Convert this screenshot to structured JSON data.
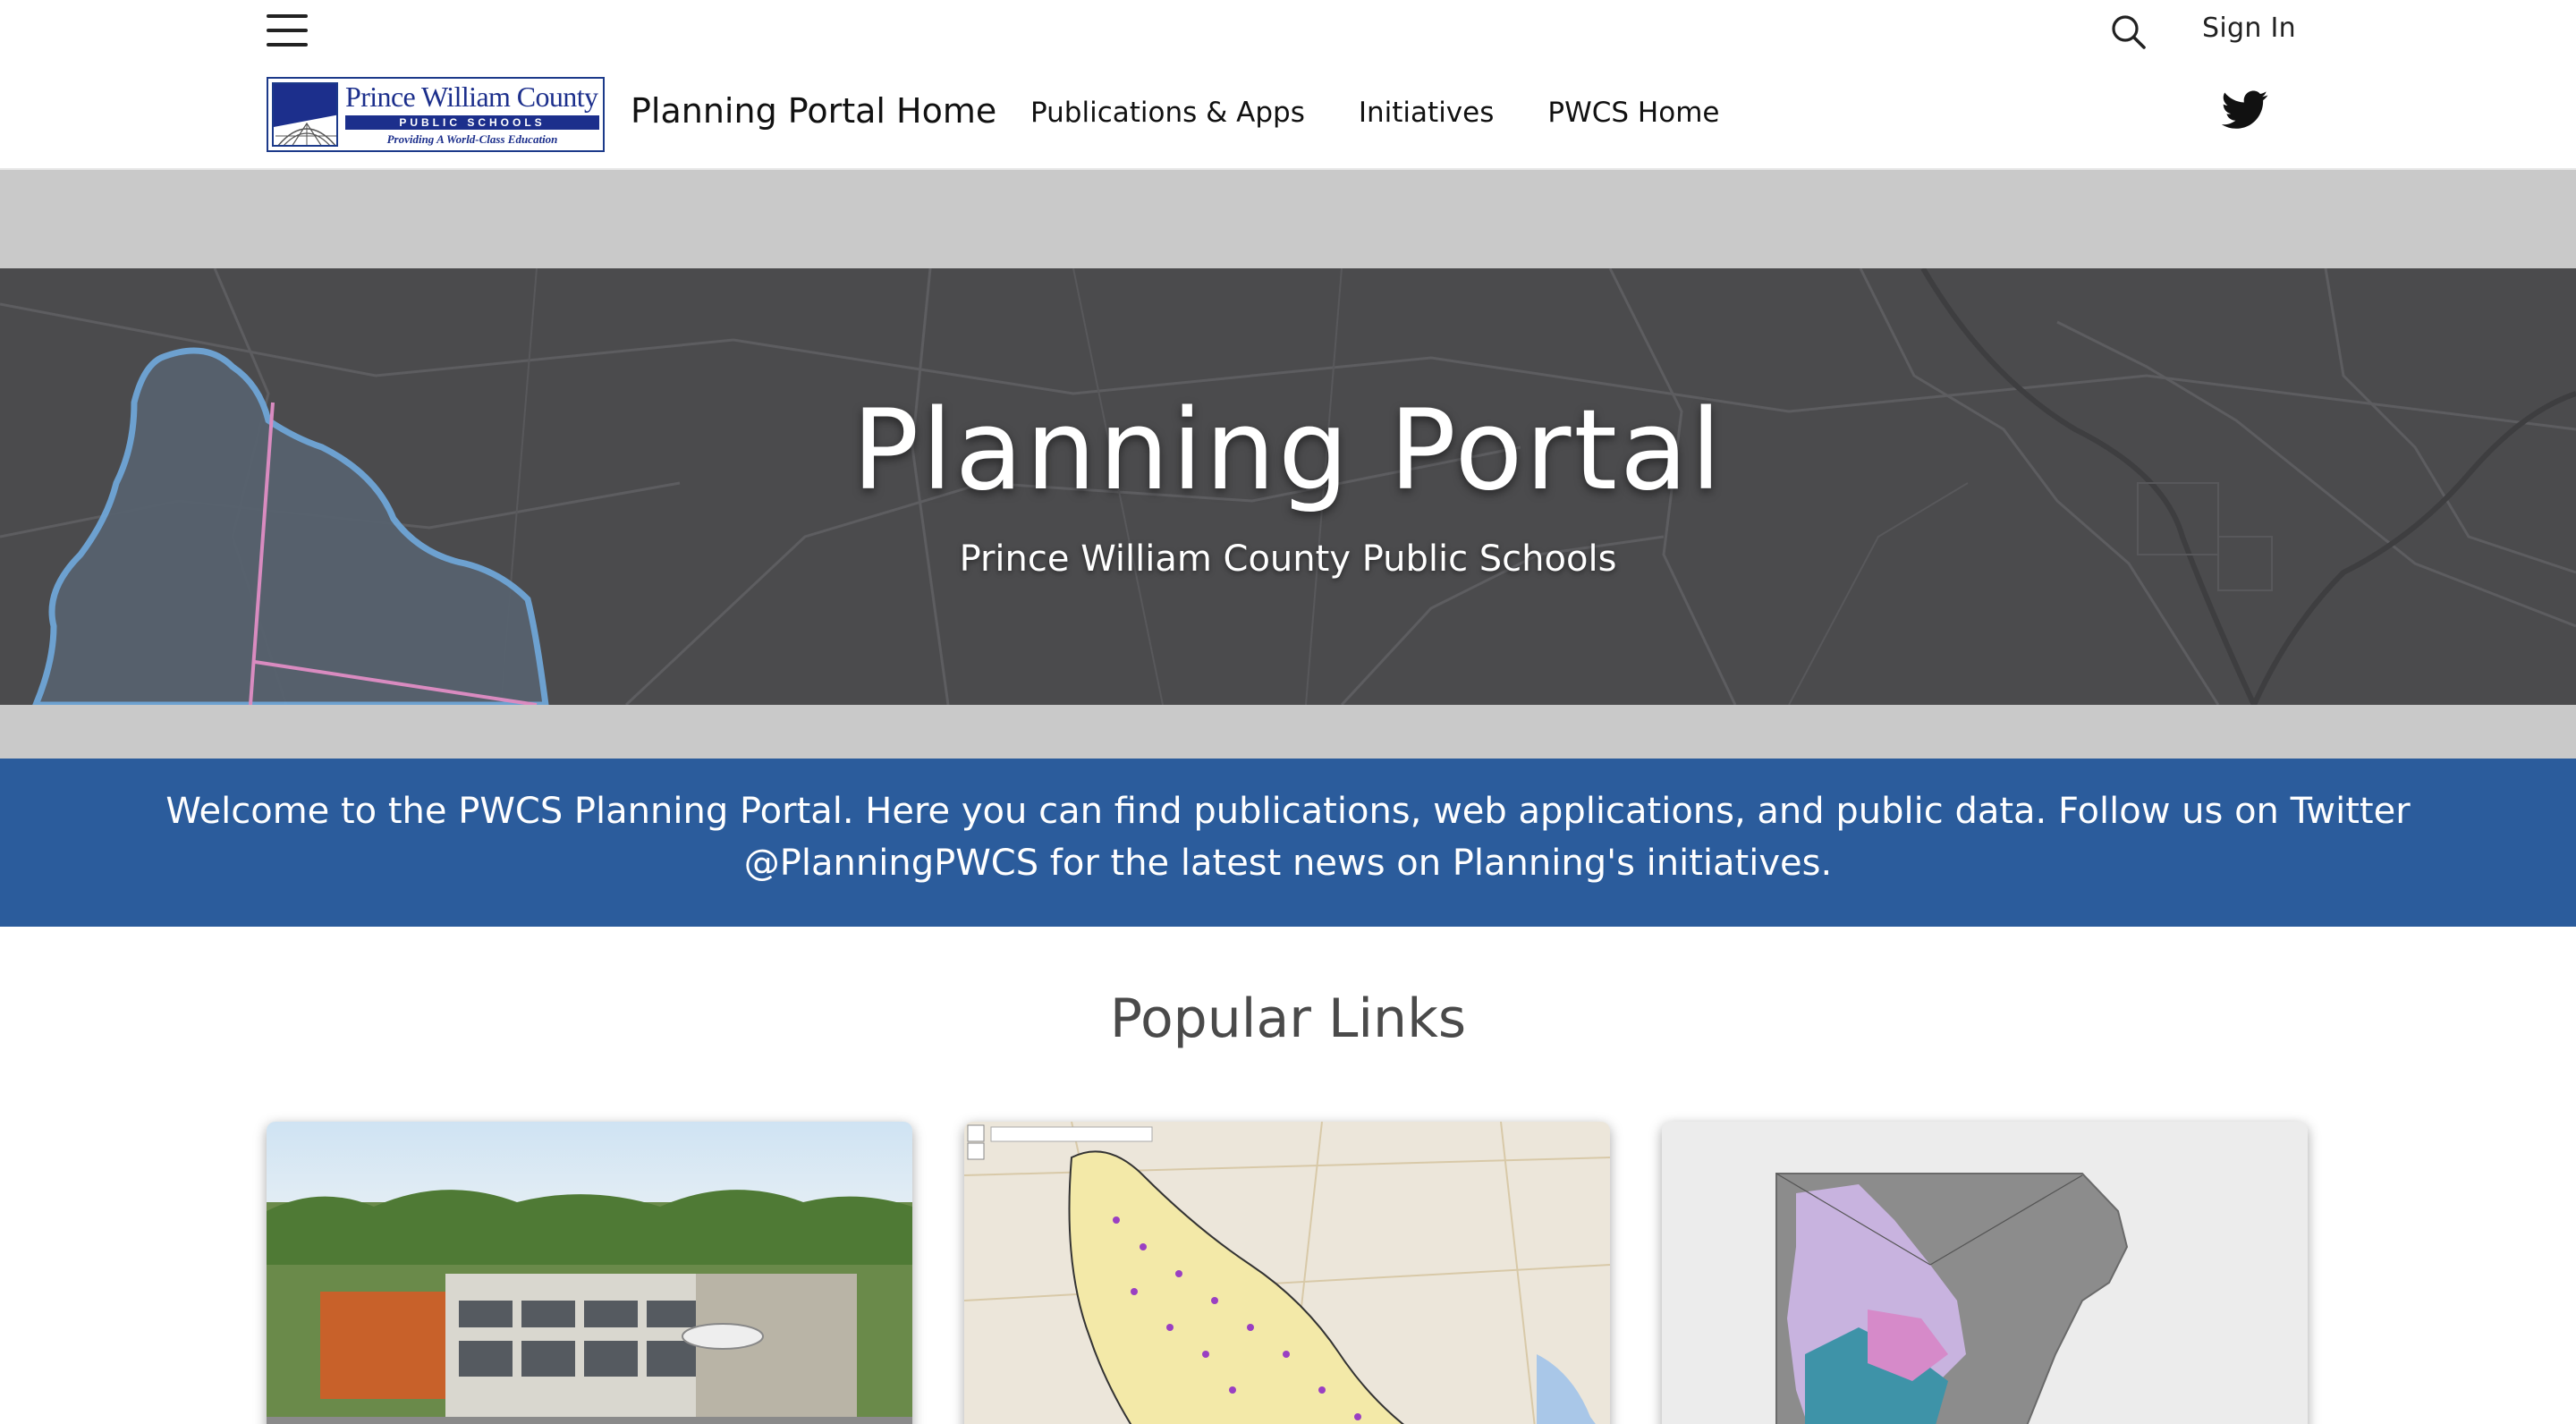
{
  "topbar": {
    "menu_icon": "hamburger-menu-icon",
    "search_icon": "search-icon",
    "signin_label": "Sign In"
  },
  "logo": {
    "name": "Prince William County",
    "band": "PUBLIC SCHOOLS",
    "motto": "Providing A World-Class Education"
  },
  "nav": {
    "site_title": "Planning Portal Home",
    "links": [
      {
        "label": "Publications & Apps"
      },
      {
        "label": "Initiatives"
      },
      {
        "label": "PWCS Home"
      }
    ],
    "twitter_icon": "twitter-bird-icon"
  },
  "hero": {
    "title": "Planning Portal",
    "subtitle": "Prince William County Public Schools"
  },
  "welcome": {
    "text": "Welcome to the PWCS Planning Portal. Here you can find publications, web applications, and public data. Follow us on Twitter @PlanningPWCS for the latest news on Planning's initiatives."
  },
  "popular": {
    "title": "Popular Links"
  },
  "colors": {
    "welcome_band": "#2b5c9c",
    "hero_bg": "#4b4b4d",
    "gap_gray": "#c9c9c9",
    "logo_navy": "#1c2f8c"
  }
}
